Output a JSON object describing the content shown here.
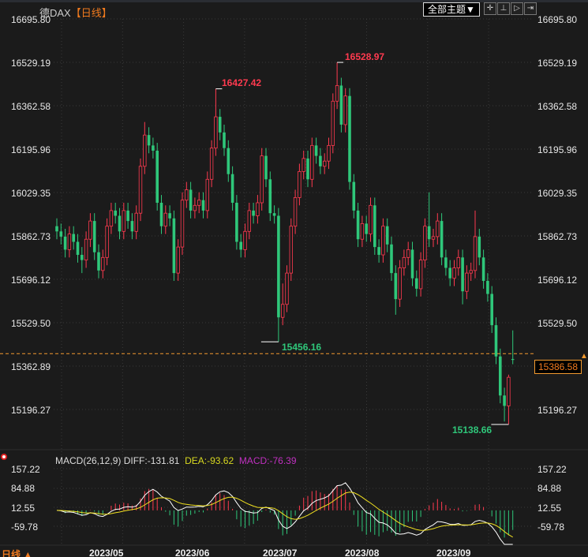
{
  "header": {
    "instrument": "德DAX",
    "period": "【日线】",
    "theme_button": "全部主题▼",
    "tools": [
      "crosshair-icon",
      "range-icon",
      "play-icon",
      "expand-icon"
    ]
  },
  "colors": {
    "up": "#ff3a4f",
    "down": "#2fc77a",
    "grid": "#3a3a3a",
    "last_price": "#f39a2e",
    "diff": "#ffffff",
    "dea": "#f0e020",
    "macd_label": "#c030c0"
  },
  "price_axis": {
    "ticks": [
      "16695.80",
      "16529.19",
      "16362.58",
      "16195.96",
      "16029.35",
      "15862.73",
      "15696.12",
      "15529.50",
      "15362.89",
      "15196.27"
    ]
  },
  "last_price": "15386.58",
  "annotations": {
    "high1": "16427.42",
    "high2": "16528.97",
    "low1": "15456.16",
    "low2": "15138.66"
  },
  "macd": {
    "label": "MACD(26,12,9)",
    "diff": "DIFF:-131.81",
    "dea": "DEA:-93.62",
    "macd": "MACD:-76.39",
    "ticks": [
      "157.22",
      "84.88",
      "12.55",
      "-59.78"
    ]
  },
  "dates": [
    "2023/05",
    "2023/06",
    "2023/07",
    "2023/08",
    "2023/09"
  ],
  "footer": {
    "period": "日线 ▲"
  },
  "chart_data": {
    "type": "candlestick",
    "ylim": [
      15138.66,
      16695.8
    ],
    "open": [
      15900,
      15880,
      15860,
      15810,
      15870,
      15840,
      15790,
      15770,
      15850,
      15920,
      15800,
      15730,
      15780,
      15900,
      15960,
      15940,
      15880,
      15960,
      15920,
      15880,
      15950,
      16130,
      16250,
      16210,
      16190,
      15990,
      15900,
      15950,
      15930,
      15720,
      15820,
      16000,
      16040,
      15960,
      15980,
      16000,
      15960,
      16080,
      16200,
      16320,
      16260,
      16200,
      16100,
      15990,
      15840,
      15810,
      15880,
      15960,
      15940,
      15990,
      16170,
      16080,
      15950,
      15940,
      15550,
      15600,
      15720,
      15900,
      16010,
      16110,
      16160,
      16080,
      16210,
      16170,
      16130,
      16150,
      16210,
      16380,
      16440,
      16290,
      16400,
      16070,
      15960,
      15850,
      15910,
      15870,
      15980,
      15820,
      15790,
      15900,
      15830,
      15720,
      15620,
      15740,
      15780,
      15810,
      15700,
      15660,
      15770,
      15900,
      15850,
      15860,
      15920,
      15780,
      15740,
      15700,
      15740,
      15780,
      15650,
      15720,
      15730,
      15860,
      15780,
      15690,
      15640,
      15520,
      15400,
      15250,
      15210,
      15390
    ],
    "high": [
      15930,
      15910,
      15890,
      15900,
      15900,
      15870,
      15820,
      15880,
      15950,
      15950,
      15830,
      15810,
      15930,
      15990,
      15990,
      15970,
      15990,
      15990,
      15950,
      15980,
      16160,
      16300,
      16280,
      16240,
      16220,
      16020,
      15980,
      15980,
      15960,
      15850,
      16030,
      16070,
      16070,
      16010,
      16030,
      16030,
      16110,
      16230,
      16427.42,
      16350,
      16290,
      16230,
      16130,
      16020,
      15870,
      15910,
      15990,
      15990,
      16020,
      16200,
      16200,
      16110,
      15980,
      15970,
      15680,
      15750,
      15930,
      16040,
      16140,
      16190,
      16190,
      16240,
      16240,
      16200,
      16180,
      16240,
      16410,
      16528.97,
      16470,
      16430,
      16430,
      16100,
      15990,
      15940,
      15940,
      16010,
      16010,
      15850,
      15930,
      15930,
      15860,
      15750,
      15770,
      15810,
      15840,
      15840,
      15730,
      15800,
      15930,
      16030,
      15890,
      15950,
      15950,
      15810,
      15770,
      15770,
      15810,
      15810,
      15750,
      15760,
      15960,
      15890,
      15810,
      15720,
      15670,
      15550,
      15430,
      15280,
      15330,
      15500
    ],
    "low": [
      15850,
      15830,
      15780,
      15780,
      15810,
      15760,
      15720,
      15740,
      15820,
      15770,
      15700,
      15700,
      15750,
      15870,
      15910,
      15850,
      15850,
      15890,
      15850,
      15850,
      15920,
      16100,
      16180,
      16160,
      15960,
      15870,
      15870,
      15900,
      15690,
      15690,
      15790,
      15970,
      15930,
      15930,
      15950,
      15930,
      15930,
      16050,
      16170,
      16230,
      16170,
      16070,
      15960,
      15810,
      15780,
      15780,
      15850,
      15910,
      15910,
      15960,
      16050,
      15920,
      15910,
      15456.16,
      15520,
      15570,
      15690,
      15870,
      15980,
      16080,
      16050,
      16050,
      16140,
      16100,
      16100,
      16120,
      16180,
      16350,
      16260,
      16260,
      16040,
      15930,
      15820,
      15820,
      15840,
      15840,
      15790,
      15760,
      15760,
      15800,
      15690,
      15560,
      15590,
      15710,
      15750,
      15670,
      15630,
      15630,
      15740,
      15820,
      15820,
      15830,
      15750,
      15710,
      15670,
      15670,
      15710,
      15600,
      15620,
      15690,
      15700,
      15750,
      15660,
      15610,
      15490,
      15370,
      15220,
      15150,
      15138.66,
      15370
    ],
    "close": [
      15880,
      15860,
      15810,
      15870,
      15840,
      15790,
      15770,
      15850,
      15920,
      15800,
      15730,
      15780,
      15900,
      15960,
      15940,
      15880,
      15960,
      15920,
      15880,
      15950,
      16130,
      16250,
      16210,
      16190,
      15990,
      15900,
      15950,
      15930,
      15720,
      15820,
      16000,
      16040,
      15960,
      15980,
      16000,
      15960,
      16080,
      16200,
      16320,
      16260,
      16200,
      16100,
      15990,
      15840,
      15810,
      15880,
      15960,
      15940,
      15990,
      16170,
      16080,
      15950,
      15940,
      15550,
      15600,
      15720,
      15900,
      16010,
      16110,
      16160,
      16080,
      16210,
      16170,
      16130,
      16150,
      16210,
      16380,
      16440,
      16290,
      16400,
      16070,
      15960,
      15850,
      15910,
      15870,
      15980,
      15820,
      15790,
      15900,
      15830,
      15720,
      15620,
      15740,
      15780,
      15810,
      15700,
      15660,
      15770,
      15900,
      15850,
      15860,
      15920,
      15780,
      15740,
      15700,
      15740,
      15780,
      15650,
      15720,
      15730,
      15860,
      15780,
      15690,
      15640,
      15520,
      15400,
      15250,
      15210,
      15320,
      15386.58
    ]
  }
}
